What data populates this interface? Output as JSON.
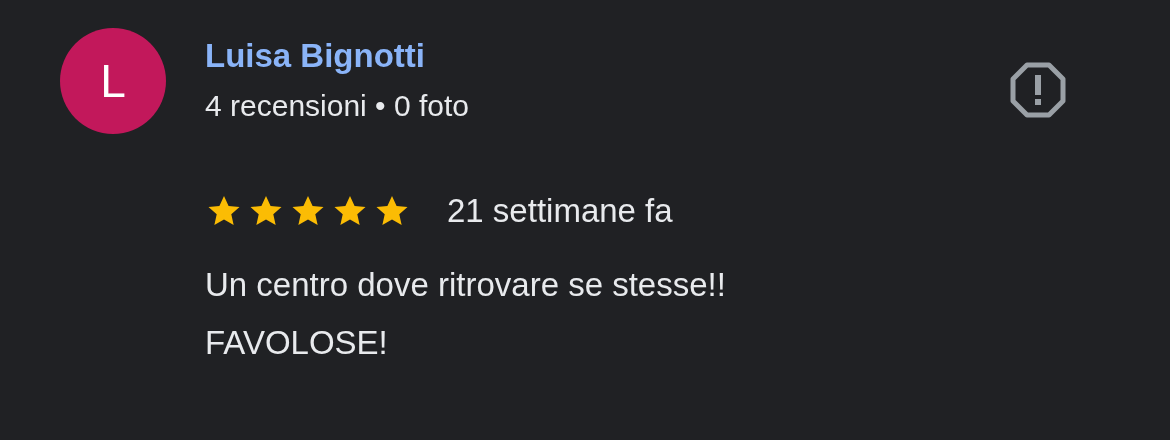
{
  "review": {
    "avatar_letter": "L",
    "author": "Luisa Bignotti",
    "meta": "4 recensioni • 0 foto",
    "stars": 5,
    "time": "21 settimane fa",
    "text": "Un centro dove ritrovare se stesse!!\nFAVOLOSE!"
  }
}
